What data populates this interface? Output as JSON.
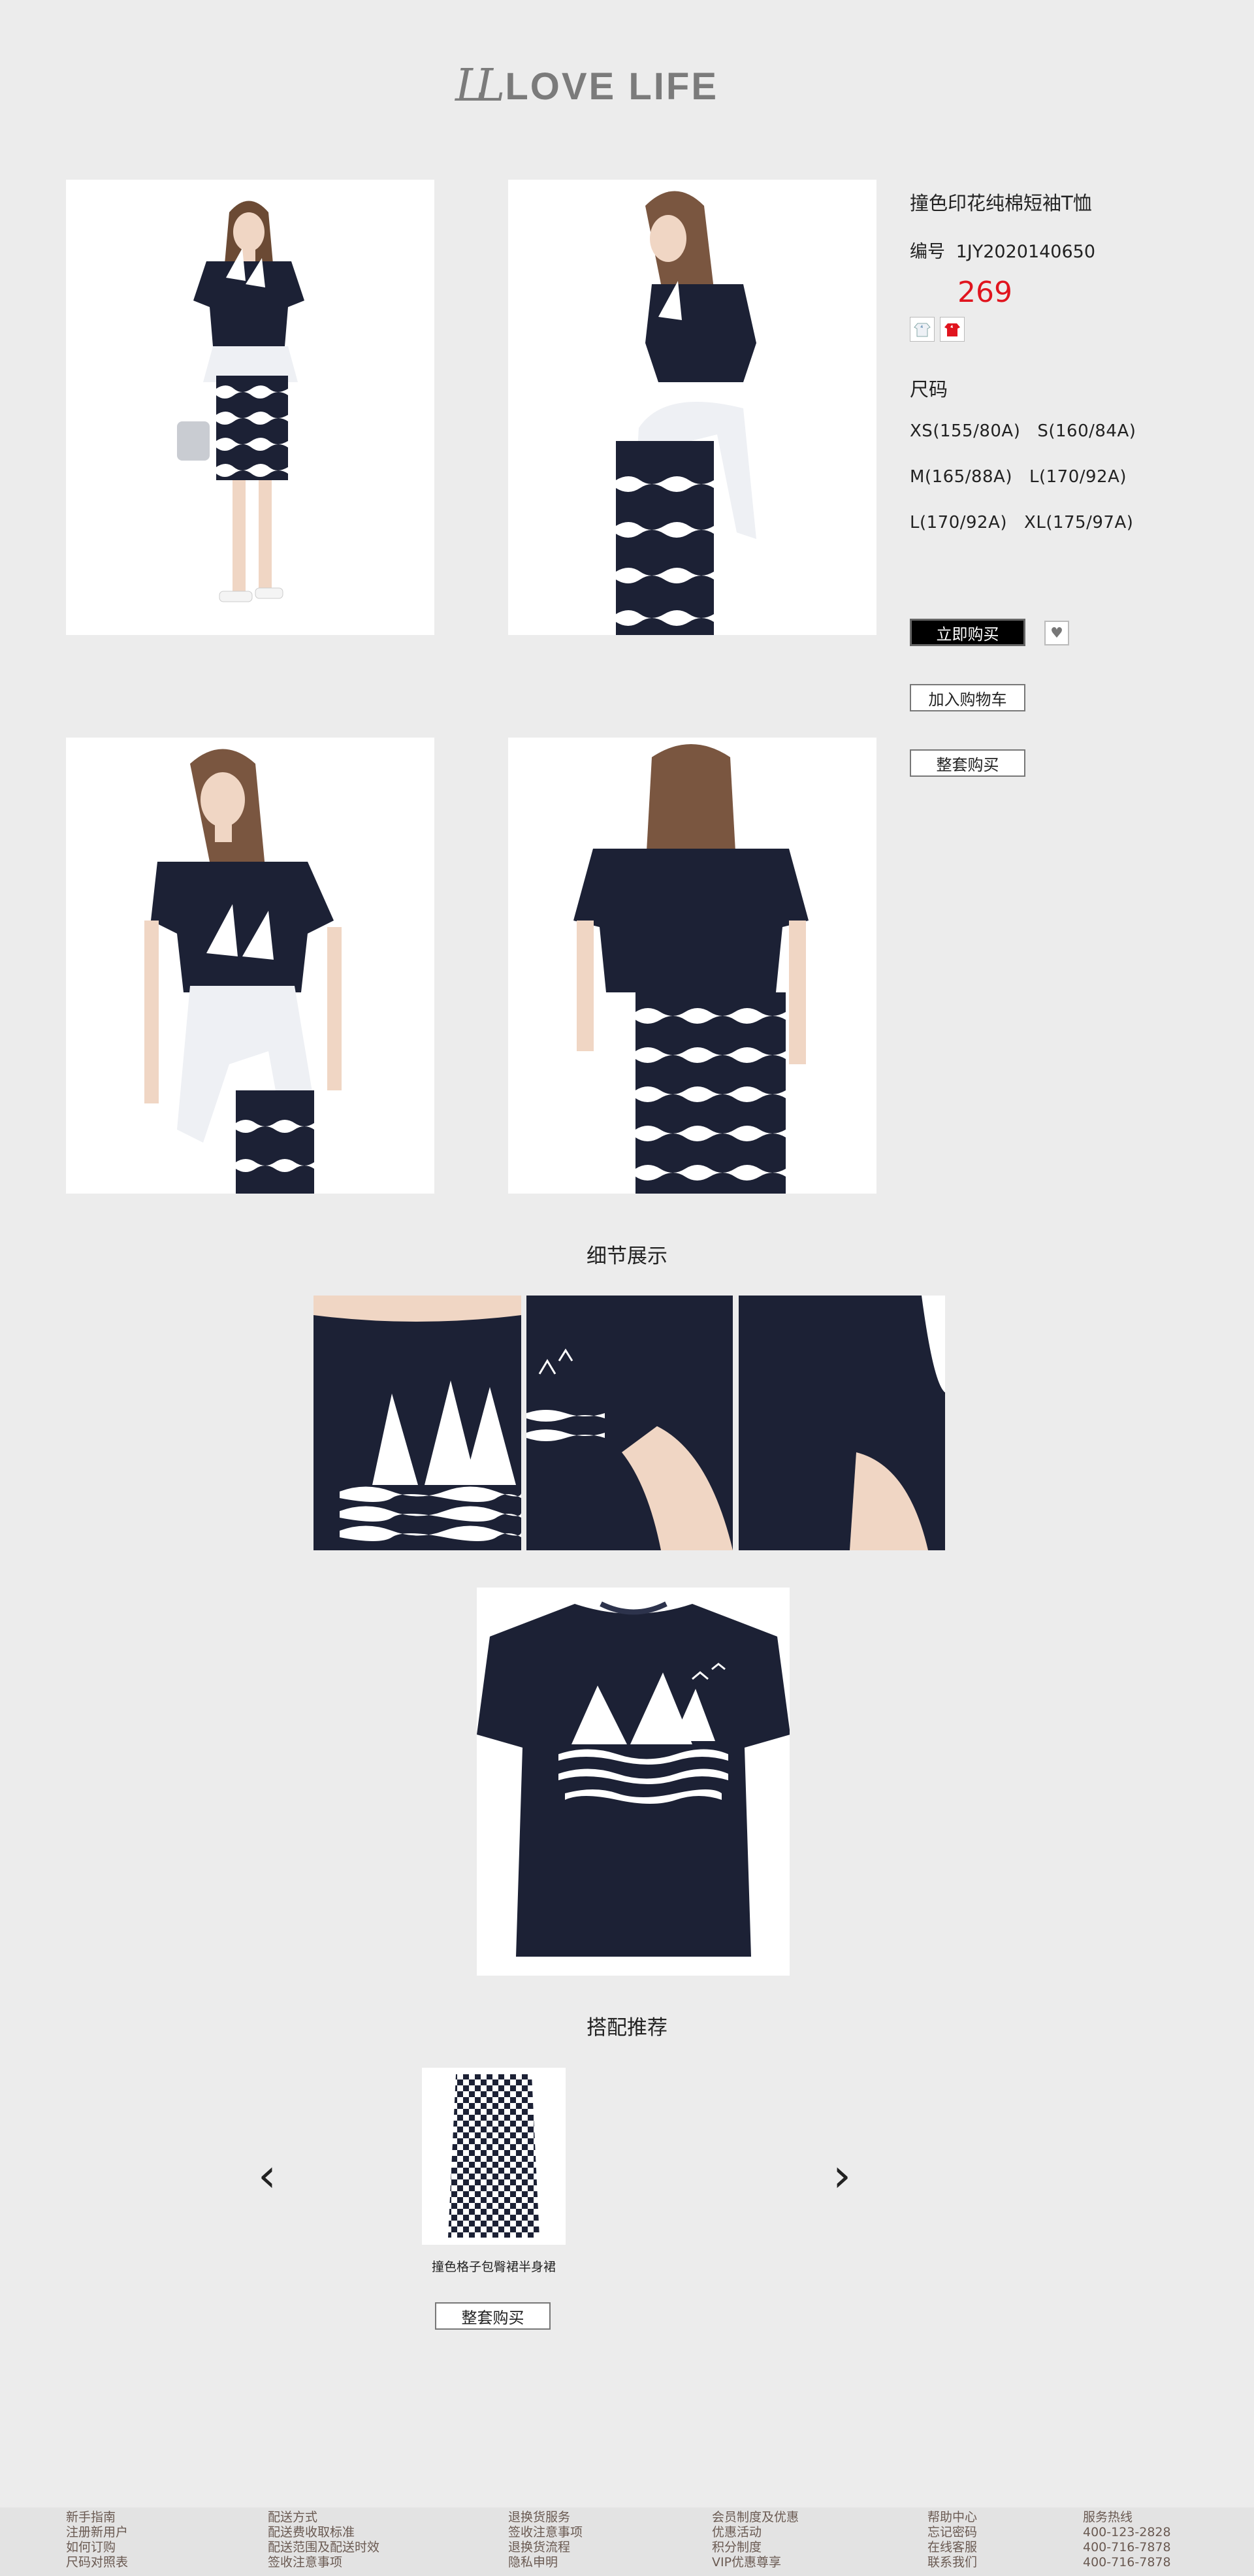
{
  "brand": {
    "mark": "LL",
    "name": "LOVE  LIFE"
  },
  "product": {
    "title": "撞色印花纯棉短袖T恤",
    "code_label": "编号",
    "code": "1JY2020140650",
    "price": "269",
    "colors": [
      "white",
      "red"
    ],
    "size_label": "尺码",
    "size_rows": [
      [
        "XS(155/80A)",
        "S(160/84A)"
      ],
      [
        "M(165/88A)",
        "L(170/92A)"
      ],
      [
        "L(170/92A)",
        "XL(175/97A)"
      ]
    ],
    "buy_now": "立即购买",
    "add_cart": "加入购物车",
    "buy_set": "整套购买"
  },
  "detail": {
    "title": "细节展示"
  },
  "recommend": {
    "title": "搭配推荐",
    "item_name": "撞色格子包臀裙半身裙",
    "buy_set": "整套购买",
    "prev": "‹",
    "next": "›"
  },
  "footer": {
    "columns": [
      [
        "新手指南",
        "注册新用户",
        "如何订购",
        "尺码对照表"
      ],
      [
        "配送方式",
        "配送费收取标准",
        "配送范围及配送时效",
        "签收注意事项"
      ],
      [
        "退换货服务",
        "签收注意事项",
        "退换货流程",
        "隐私申明"
      ],
      [
        "会员制度及优惠",
        "优惠活动",
        "积分制度",
        "VIP优惠尊享"
      ],
      [
        "帮助中心",
        "忘记密码",
        "在线客服",
        "联系我们"
      ],
      [
        "服务热线",
        "400-123-2828",
        "400-716-7878",
        "400-716-7878"
      ]
    ]
  },
  "colors": {
    "navy": "#1c2135",
    "price": "#e0141e",
    "bg": "#ececec"
  }
}
